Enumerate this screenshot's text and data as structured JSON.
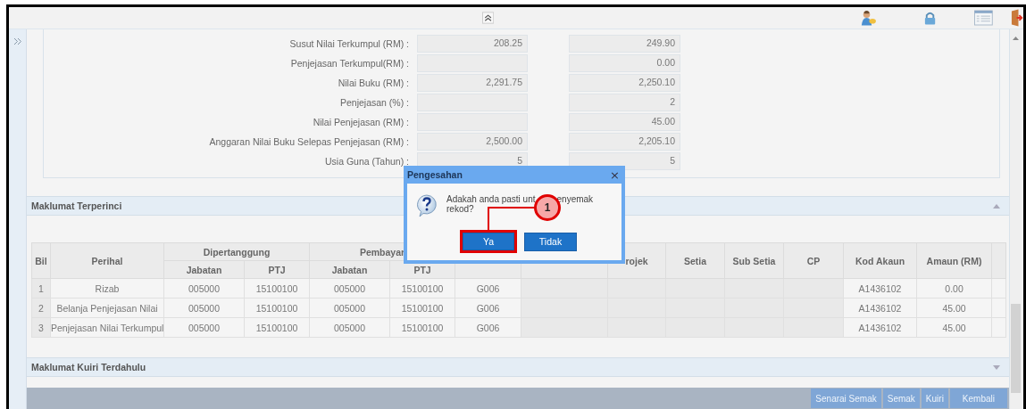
{
  "form_rows": [
    {
      "label": "Susut Nilai Terkumpul (RM) :",
      "value_1": "208.25",
      "value_2": "249.90"
    },
    {
      "label": "Penjejasan Terkumpul(RM) :",
      "value_2": "0.00"
    },
    {
      "label": "Nilai Buku (RM) :",
      "value_1": "2,291.75",
      "value_2": "2,250.10"
    },
    {
      "label": "Penjejasan (%) :",
      "value_2": "2"
    },
    {
      "label": "Nilai Penjejasan (RM) :",
      "value_2": "45.00"
    },
    {
      "label": "Anggaran Nilai Buku Selepas Penjejasan (RM) :",
      "value_1": "2,500.00",
      "value_2": "2,205.10"
    },
    {
      "label": "Usia Guna (Tahun) :",
      "value_1": "5",
      "value_2": "5"
    }
  ],
  "sections": [
    {
      "title": "Maklumat Terperinci",
      "expanded": true
    },
    {
      "title": "Maklumat Kuiri Terdahulu",
      "expanded": false
    }
  ],
  "table": {
    "headers": [
      {
        "label": "Bil",
        "shaded": true
      },
      {
        "label": "Perihal",
        "shaded": false
      },
      {
        "label": "Dipertanggung",
        "sub": [
          "Jabatan",
          "PTJ"
        ],
        "shaded": false
      },
      {
        "label": "Pembayar",
        "sub": [
          "Jabatan",
          "PTJ"
        ],
        "shaded": false
      },
      {
        "shaded": false
      },
      {
        "shaded": true
      },
      {
        "label": "rojek",
        "shaded": true
      },
      {
        "label": "Setia",
        "shaded": true
      },
      {
        "label": "Sub Setia",
        "shaded": true
      },
      {
        "label": "CP",
        "shaded": true
      },
      {
        "label": "Kod Akaun",
        "shaded": false
      },
      {
        "label": "Amaun (RM)",
        "shaded": false
      },
      {
        "shaded": false
      }
    ],
    "rows": [
      [
        "1",
        "Rizab",
        "005000",
        "15100100",
        "005000",
        "15100100",
        "G006",
        null,
        null,
        null,
        null,
        null,
        "A1436102",
        "0.00",
        null
      ],
      [
        "2",
        "Belanja Penjejasan Nilai",
        "005000",
        "15100100",
        "005000",
        "15100100",
        "G006",
        null,
        null,
        null,
        null,
        null,
        "A1436102",
        "45.00",
        null
      ],
      [
        "3",
        "Penjejasan Nilai Terkumpul",
        "005000",
        "15100100",
        "005000",
        "15100100",
        "G006",
        null,
        null,
        null,
        null,
        null,
        "A1436102",
        "45.00",
        null
      ]
    ]
  },
  "buttons": [
    "Senarai Semak",
    "Semak",
    "Kuiri",
    "Kembali"
  ],
  "dialog": {
    "title": "Pengesahan",
    "close": "×",
    "message_start": "Adakah anda pasti unt",
    "message_end": "enyemak",
    "message_line_2": "rekod?",
    "buttons": [
      {
        "label": "Ya",
        "highlighted": true
      },
      {
        "label": "Tidak",
        "highlighted": false
      }
    ]
  },
  "callout": {
    "label": "1"
  }
}
